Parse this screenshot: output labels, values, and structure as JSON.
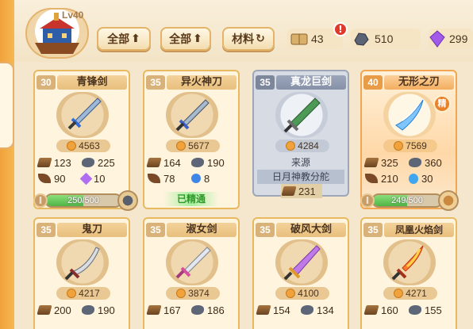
{
  "header": {
    "level": "Lv40",
    "buttons": [
      {
        "label": "全部",
        "icon": "arrow-up-icon"
      },
      {
        "label": "全部",
        "icon": "arrow-up-icon"
      },
      {
        "label": "材料",
        "icon": "refresh-icon"
      }
    ],
    "book_count": "43",
    "alert": "!",
    "ore_count": "510",
    "gem_count": "299"
  },
  "cards": [
    {
      "level": "30",
      "name": "青锋剑",
      "power": "4563",
      "stats": [
        [
          "123",
          "225"
        ],
        [
          "90",
          "10"
        ]
      ],
      "progress_text": "250/500",
      "progress": 0.5
    },
    {
      "level": "35",
      "name": "异火神刀",
      "power": "5677",
      "stats": [
        [
          "164",
          "190"
        ],
        [
          "78",
          "8"
        ]
      ],
      "status": "已精通"
    },
    {
      "level": "35",
      "name": "真龙巨剑",
      "power": "4284",
      "source_label": "来源",
      "source": "日月神教分舵",
      "cost": "231"
    },
    {
      "level": "40",
      "name": "无形之刃",
      "power": "7569",
      "badge": "精",
      "stats": [
        [
          "325",
          "360"
        ],
        [
          "210",
          "30"
        ]
      ],
      "progress_text": "249/500",
      "progress": 0.498
    },
    {
      "level": "35",
      "name": "鬼刀",
      "power": "4217",
      "stats": [
        [
          "200",
          "190"
        ]
      ]
    },
    {
      "level": "35",
      "name": "淑女剑",
      "power": "3874",
      "stats": [
        [
          "167",
          "186"
        ]
      ]
    },
    {
      "level": "35",
      "name": "破风大剑",
      "power": "4100",
      "stats": [
        [
          "154",
          "134"
        ]
      ]
    },
    {
      "level": "35",
      "name": "凤凰火焰剑",
      "power": "4271",
      "stats": [
        [
          "160",
          "155"
        ]
      ]
    }
  ]
}
